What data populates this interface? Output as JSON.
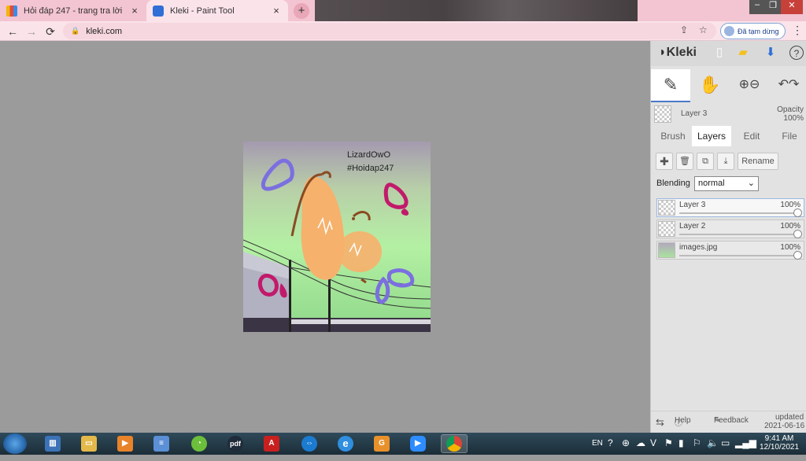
{
  "browser": {
    "tabs": [
      {
        "title": "Hỏi đáp 247 - trang tra lời",
        "active": false
      },
      {
        "title": "Kleki - Paint Tool",
        "active": true
      }
    ],
    "new_tab_label": "+",
    "url": "kleki.com",
    "profile_status": "Đã tạm dừng",
    "close_glyph": "×",
    "back_glyph": "←",
    "forward_glyph": "→",
    "reload_glyph": "⟳",
    "menu_glyph": "⋮"
  },
  "canvas": {
    "watermark_line1": "LizardOwO",
    "watermark_line2": "#Hoidap247"
  },
  "kleki": {
    "logo": "Kleki",
    "active_layer_name": "Layer 3",
    "opacity_label": "Opacity",
    "opacity_value": "100%",
    "tabs": [
      "Brush",
      "Layers",
      "Edit",
      "File"
    ],
    "active_tab": "Layers",
    "rename_label": "Rename",
    "blending_label": "Blending",
    "blending_value": "normal",
    "layers": [
      {
        "name": "Layer 3",
        "opacity": "100%",
        "selected": true
      },
      {
        "name": "Layer 2",
        "opacity": "100%",
        "selected": false
      },
      {
        "name": "images.jpg",
        "opacity": "100%",
        "selected": false
      }
    ],
    "footer": {
      "help": "Help",
      "feedback": "Feedback",
      "updated_label": "updated",
      "updated_date": "2021-06-16"
    }
  },
  "taskbar": {
    "language": "EN",
    "time": "9:41 AM",
    "date": "12/10/2021",
    "pdf_label": "pdf"
  },
  "colors": {
    "tabstrip": "#f3c4d1",
    "toolbar": "#fbe3ea",
    "accent": "#4a79c9"
  }
}
